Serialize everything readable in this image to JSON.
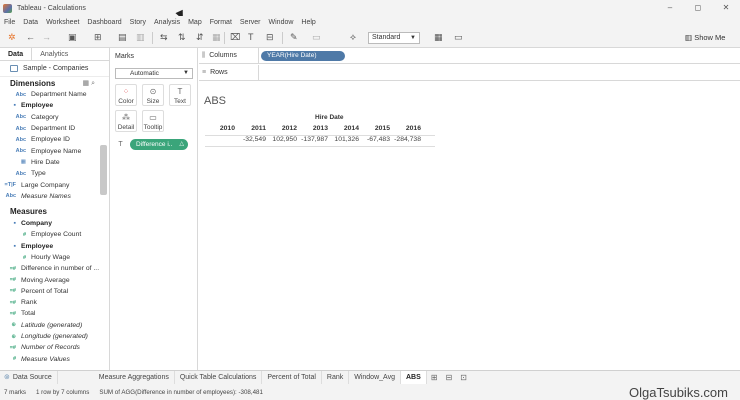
{
  "window": {
    "title": "Tableau - Calculations",
    "controls": [
      "–",
      "◻",
      "✕"
    ]
  },
  "menu": [
    "File",
    "Data",
    "Worksheet",
    "Dashboard",
    "Story",
    "Analysis",
    "Map",
    "Format",
    "Server",
    "Window",
    "Help"
  ],
  "toolbar": {
    "fit": "Standard",
    "show_me": "Show Me"
  },
  "left_pane": {
    "tabs": {
      "data": "Data",
      "analytics": "Analytics"
    },
    "data_source": "Sample - Companies",
    "dimensions_header": "Dimensions",
    "dimensions": [
      {
        "icon": "Abc",
        "label": "Department Name",
        "indent": true,
        "type": "dim"
      },
      {
        "icon": "▪",
        "label": "Employee",
        "group": true,
        "type": "grp"
      },
      {
        "icon": "Abc",
        "label": "Category",
        "indent": true,
        "type": "dim"
      },
      {
        "icon": "Abc",
        "label": "Department ID",
        "indent": true,
        "type": "dim"
      },
      {
        "icon": "Abc",
        "label": "Employee ID",
        "indent": true,
        "type": "dim"
      },
      {
        "icon": "Abc",
        "label": "Employee Name",
        "indent": true,
        "type": "dim"
      },
      {
        "icon": "▦",
        "label": "Hire Date",
        "indent": true,
        "type": "dim"
      },
      {
        "icon": "Abc",
        "label": "Type",
        "indent": true,
        "type": "dim"
      },
      {
        "icon": "=T|F",
        "label": "Large Company",
        "indent": false,
        "type": "dim"
      },
      {
        "icon": "Abc",
        "label": "Measure Names",
        "indent": false,
        "type": "dim",
        "italic": true
      }
    ],
    "measures_header": "Measures",
    "measures": [
      {
        "icon": "▪",
        "label": "Company",
        "group": true,
        "type": "grp"
      },
      {
        "icon": "#",
        "label": "Employee Count",
        "indent": true,
        "type": "meas"
      },
      {
        "icon": "▪",
        "label": "Employee",
        "group": true,
        "type": "grp"
      },
      {
        "icon": "#",
        "label": "Hourly Wage",
        "indent": true,
        "type": "meas"
      },
      {
        "icon": "=#",
        "label": "Difference in number of ...",
        "indent": false,
        "type": "meas"
      },
      {
        "icon": "=#",
        "label": "Moving Average",
        "indent": false,
        "type": "meas"
      },
      {
        "icon": "=#",
        "label": "Percent of Total",
        "indent": false,
        "type": "meas"
      },
      {
        "icon": "=#",
        "label": "Rank",
        "indent": false,
        "type": "meas"
      },
      {
        "icon": "=#",
        "label": "Total",
        "indent": false,
        "type": "meas"
      },
      {
        "icon": "⊕",
        "label": "Latitude (generated)",
        "indent": false,
        "type": "meas",
        "italic": true
      },
      {
        "icon": "⊕",
        "label": "Longitude (generated)",
        "indent": false,
        "type": "meas",
        "italic": true
      },
      {
        "icon": "=#",
        "label": "Number of Records",
        "indent": false,
        "type": "meas",
        "italic": true
      },
      {
        "icon": "#",
        "label": "Measure Values",
        "indent": false,
        "type": "meas",
        "italic": true
      }
    ]
  },
  "marks": {
    "header": "Marks",
    "type": "Automatic",
    "buttons": {
      "color": "Color",
      "size": "Size",
      "text": "Text",
      "detail": "Detail",
      "tooltip": "Tooltip"
    },
    "pill": "Difference i..",
    "pill_delta": "△"
  },
  "shelves": {
    "columns_label": "Columns",
    "rows_label": "Rows",
    "columns_pill": "YEAR(Hire Date)"
  },
  "viz": {
    "sheet_title": "ABS",
    "column_header": "Hire Date",
    "years": [
      "2010",
      "2011",
      "2012",
      "2013",
      "2014",
      "2015",
      "2016"
    ],
    "values": [
      "",
      "-32,549",
      "102,950",
      "-137,987",
      "101,326",
      "-67,483",
      "-284,738"
    ]
  },
  "sheet_tabs": {
    "data_source": "Data Source",
    "tabs": [
      "Measure Aggregations",
      "Quick Table Calculations",
      "Percent of Total",
      "Rank",
      "Window_Avg",
      "ABS"
    ],
    "active": "ABS"
  },
  "status": {
    "marks": "7 marks",
    "rows_cols": "1 row by 7 columns",
    "sum": "SUM of AGG(Difference in number of employees): -308,481"
  },
  "watermark": "OlgaTsubiks.com"
}
